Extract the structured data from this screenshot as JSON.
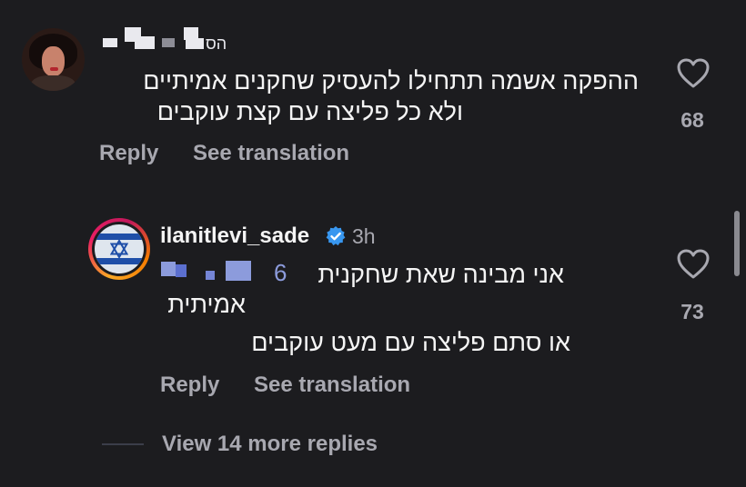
{
  "comment1": {
    "username_partial": "הס",
    "lines": [
      "ההפקה אשמה תתחילו להעסיק שחקנים אמיתיים",
      "ולא כל פליצה עם קצת עוקבים"
    ],
    "reply_label": "Reply",
    "translate_label": "See translation",
    "likes": "68"
  },
  "comment2": {
    "username": "ilanitlevi_sade",
    "time": "3h",
    "mention_suffix": "6",
    "lines": [
      "אני מבינה שאת שחקנית",
      "אמיתית",
      "או סתם פליצה עם מעט עוקבים"
    ],
    "reply_label": "Reply",
    "translate_label": "See translation",
    "likes": "73"
  },
  "view_more": "View 14 more replies",
  "icons": {
    "like": "heart-outline-icon",
    "verified": "verified-badge-icon"
  },
  "colors": {
    "background": "#1c1c1f",
    "secondary_text": "#a8a8b0",
    "verified_blue": "#3897f0"
  }
}
